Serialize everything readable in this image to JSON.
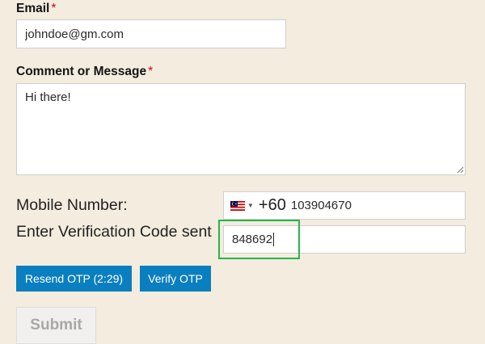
{
  "email": {
    "label": "Email",
    "required_mark": "*",
    "value": "johndoe@gm.com"
  },
  "comment": {
    "label": "Comment or Message",
    "required_mark": "*",
    "value": "Hi there!"
  },
  "mobile": {
    "label": "Mobile Number:",
    "country_flag": "malaysia-flag",
    "country_code": "+60",
    "number": "103904670"
  },
  "verification": {
    "label": "Enter Verification Code sent",
    "value": "848692",
    "highlight_color": "#27b54a"
  },
  "buttons": {
    "resend": "Resend OTP (2:29)",
    "verify": "Verify OTP",
    "submit": "Submit"
  },
  "colors": {
    "background": "#f3ecdf",
    "primary_button": "#0a7fbf",
    "required": "#d0021b"
  }
}
